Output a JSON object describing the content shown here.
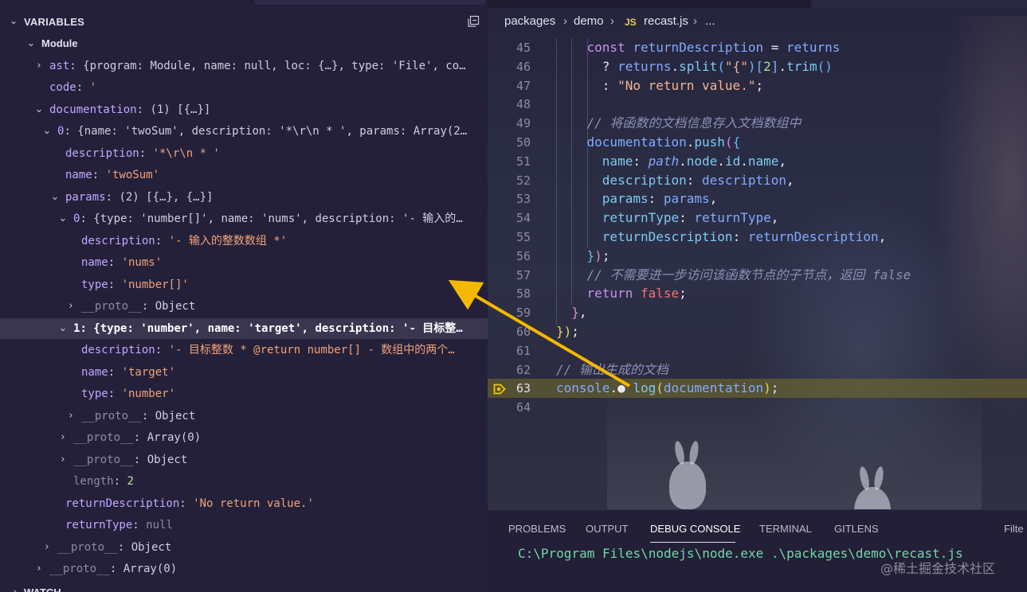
{
  "variables_panel": {
    "title": "VARIABLES",
    "title_chevron": "⌄",
    "collapse_icon": "collapse-all-icon",
    "rows": [
      {
        "indent": 0,
        "twisty": "⌄",
        "key": "Module",
        "kind": "scope"
      },
      {
        "indent": 1,
        "twisty": "›",
        "key": "ast",
        "value": "{program: Module, name: null, loc: {…}, type: 'File', co…"
      },
      {
        "indent": 1,
        "twisty": "",
        "key": "code",
        "value_str": "'"
      },
      {
        "indent": 1,
        "twisty": "⌄",
        "key": "documentation",
        "value": "(1) [{…}]"
      },
      {
        "indent": 2,
        "twisty": "⌄",
        "key": "0",
        "value": "{name: 'twoSum', description: '*\\r\\n * ', params: Array(2…"
      },
      {
        "indent": 3,
        "twisty": "",
        "key": "description",
        "value_str": "'*\\r\\n * '"
      },
      {
        "indent": 3,
        "twisty": "",
        "key": "name",
        "value_str": "'twoSum'"
      },
      {
        "indent": 3,
        "twisty": "⌄",
        "key": "params",
        "value": "(2) [{…}, {…}]"
      },
      {
        "indent": 4,
        "twisty": "⌄",
        "key": "0",
        "value": "{type: 'number[]', name: 'nums', description: '- 输入的…"
      },
      {
        "indent": 5,
        "twisty": "",
        "key": "description",
        "value_str": "'- 输入的整数数组 *'"
      },
      {
        "indent": 5,
        "twisty": "",
        "key": "name",
        "value_str": "'nums'"
      },
      {
        "indent": 5,
        "twisty": "",
        "key": "type",
        "value_str": "'number[]'"
      },
      {
        "indent": 5,
        "twisty": "›",
        "key": "__proto__",
        "value": "Object",
        "proto": true
      },
      {
        "indent": 4,
        "twisty": "⌄",
        "key": "1",
        "value": "{type: 'number', name: 'target', description: '- 目标整…",
        "selected": true
      },
      {
        "indent": 5,
        "twisty": "",
        "key": "description",
        "value_str": "'- 目标整数 * @return number[] - 数组中的两个…"
      },
      {
        "indent": 5,
        "twisty": "",
        "key": "name",
        "value_str": "'target'"
      },
      {
        "indent": 5,
        "twisty": "",
        "key": "type",
        "value_str": "'number'"
      },
      {
        "indent": 5,
        "twisty": "›",
        "key": "__proto__",
        "value": "Object",
        "proto": true
      },
      {
        "indent": 4,
        "twisty": "›",
        "key": "__proto__",
        "value": "Array(0)",
        "proto": true
      },
      {
        "indent": 4,
        "twisty": "›",
        "key": "__proto__",
        "value": "Object",
        "proto": true
      },
      {
        "indent": 4,
        "twisty": "",
        "key": "length",
        "value_num": "2",
        "proto": true
      },
      {
        "indent": 3,
        "twisty": "",
        "key": "returnDescription",
        "value_str": "'No return value.'"
      },
      {
        "indent": 3,
        "twisty": "",
        "key": "returnType",
        "value_null": "null"
      },
      {
        "indent": 2,
        "twisty": "›",
        "key": "__proto__",
        "value": "Object",
        "proto": true
      },
      {
        "indent": 1,
        "twisty": "›",
        "key": "__proto__",
        "value": "Array(0)",
        "proto": true
      }
    ],
    "next_section": "WATCH"
  },
  "breadcrumb": {
    "part1": "packages",
    "part2": "demo",
    "file_icon": "JS",
    "part3": "recast.js",
    "part4": "..."
  },
  "editor": {
    "current_line": 63,
    "breakpoint_icon": "debug-stackframe-icon",
    "lines": [
      {
        "n": "45",
        "segs": [
          [
            "    const ",
            "c-kw"
          ],
          [
            "returnDescription",
            "c-var"
          ],
          [
            " = ",
            "c-punc"
          ],
          [
            "returns",
            "c-var"
          ]
        ]
      },
      {
        "n": "46",
        "segs": [
          [
            "      ? ",
            "c-punc"
          ],
          [
            "returns",
            "c-var"
          ],
          [
            ".",
            "c-punc"
          ],
          [
            "split",
            "c-fn"
          ],
          [
            "(",
            "c-br3"
          ],
          [
            "\"{\"",
            "c-str"
          ],
          [
            ")",
            "c-br3"
          ],
          [
            "[",
            "c-br3"
          ],
          [
            "2",
            "c-num"
          ],
          [
            "]",
            "c-br3"
          ],
          [
            ".",
            "c-punc"
          ],
          [
            "trim",
            "c-fn"
          ],
          [
            "()",
            "c-br3"
          ]
        ]
      },
      {
        "n": "47",
        "segs": [
          [
            "      : ",
            "c-punc"
          ],
          [
            "\"No return value.\"",
            "c-str"
          ],
          [
            ";",
            "c-punc"
          ]
        ]
      },
      {
        "n": "48",
        "segs": []
      },
      {
        "n": "49",
        "segs": [
          [
            "    // 将函数的文档信息存入文档数组中",
            "c-cm"
          ]
        ]
      },
      {
        "n": "50",
        "segs": [
          [
            "    documentation",
            "c-var"
          ],
          [
            ".",
            "c-punc"
          ],
          [
            "push",
            "c-fn"
          ],
          [
            "(",
            "c-br2"
          ],
          [
            "{",
            "c-br3"
          ]
        ]
      },
      {
        "n": "51",
        "segs": [
          [
            "      name",
            "c-prop"
          ],
          [
            ": ",
            "c-punc"
          ],
          [
            "path",
            "c-it"
          ],
          [
            ".",
            "c-punc"
          ],
          [
            "node",
            "c-prop"
          ],
          [
            ".",
            "c-punc"
          ],
          [
            "id",
            "c-prop"
          ],
          [
            ".",
            "c-punc"
          ],
          [
            "name",
            "c-prop"
          ],
          [
            ",",
            "c-punc"
          ]
        ]
      },
      {
        "n": "52",
        "segs": [
          [
            "      description",
            "c-prop"
          ],
          [
            ": ",
            "c-punc"
          ],
          [
            "description",
            "c-var"
          ],
          [
            ",",
            "c-punc"
          ]
        ]
      },
      {
        "n": "53",
        "segs": [
          [
            "      params",
            "c-prop"
          ],
          [
            ": ",
            "c-punc"
          ],
          [
            "params",
            "c-var"
          ],
          [
            ",",
            "c-punc"
          ]
        ]
      },
      {
        "n": "54",
        "segs": [
          [
            "      returnType",
            "c-prop"
          ],
          [
            ": ",
            "c-punc"
          ],
          [
            "returnType",
            "c-var"
          ],
          [
            ",",
            "c-punc"
          ]
        ]
      },
      {
        "n": "55",
        "segs": [
          [
            "      returnDescription",
            "c-prop"
          ],
          [
            ": ",
            "c-punc"
          ],
          [
            "returnDescription",
            "c-var"
          ],
          [
            ",",
            "c-punc"
          ]
        ]
      },
      {
        "n": "56",
        "segs": [
          [
            "    ",
            "c-punc"
          ],
          [
            "}",
            "c-br3"
          ],
          [
            ")",
            "c-br2"
          ],
          [
            ";",
            "c-punc"
          ]
        ]
      },
      {
        "n": "57",
        "segs": [
          [
            "    // 不需要进一步访问该函数节点的子节点，返回 false",
            "c-cm"
          ]
        ]
      },
      {
        "n": "58",
        "segs": [
          [
            "    return ",
            "c-kw"
          ],
          [
            "false",
            "c-bool"
          ],
          [
            ";",
            "c-punc"
          ]
        ]
      },
      {
        "n": "59",
        "segs": [
          [
            "  ",
            "c-punc"
          ],
          [
            "}",
            "c-br2"
          ],
          [
            ",",
            "c-punc"
          ]
        ]
      },
      {
        "n": "60",
        "segs": [
          [
            "}",
            "c-br1"
          ],
          [
            ")",
            "c-br1"
          ],
          [
            ";",
            "c-punc"
          ]
        ]
      },
      {
        "n": "61",
        "segs": []
      },
      {
        "n": "62",
        "segs": [
          [
            "// 输出生成的文档",
            "c-cm"
          ]
        ]
      },
      {
        "n": "63",
        "segs": [
          [
            "console",
            "c-var"
          ],
          [
            ".",
            "c-punc"
          ],
          [
            "● ",
            "c-plain"
          ],
          [
            "log",
            "c-fn"
          ],
          [
            "(",
            "c-br1"
          ],
          [
            "documentation",
            "c-var"
          ],
          [
            ")",
            "c-br1"
          ],
          [
            ";",
            "c-punc"
          ]
        ]
      },
      {
        "n": "64",
        "segs": []
      }
    ]
  },
  "bottom_panel": {
    "tabs": [
      "PROBLEMS",
      "OUTPUT",
      "DEBUG CONSOLE",
      "TERMINAL",
      "GITLENS"
    ],
    "active_tab": "DEBUG CONSOLE",
    "filter_label": "Filte",
    "console_output": "C:\\Program Files\\nodejs\\node.exe .\\packages\\demo\\recast.js",
    "watermark": "@稀土掘金技术社区"
  },
  "colors": {
    "arrow": "#f5b800",
    "current_line_bg": "#787028",
    "panel_bg": "#24203a"
  }
}
